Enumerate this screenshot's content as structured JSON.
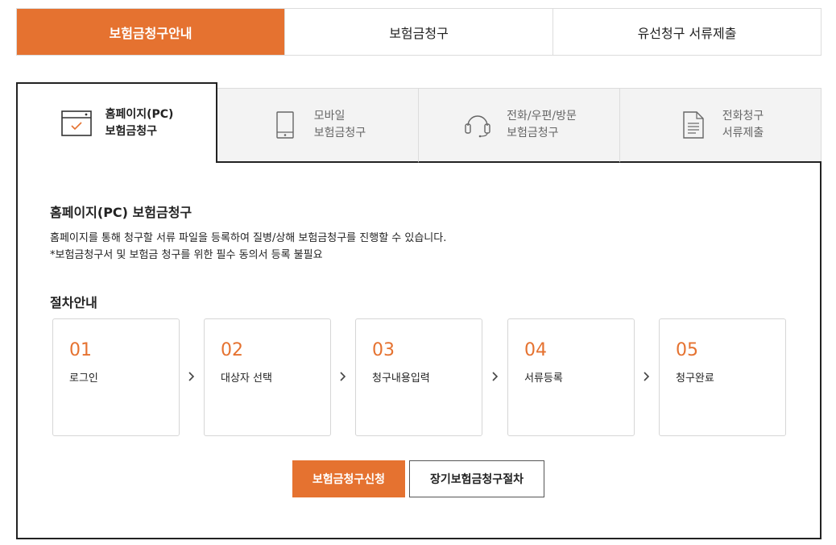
{
  "top_tabs": [
    {
      "label": "보험금청구안내",
      "active": true
    },
    {
      "label": "보험금청구",
      "active": false
    },
    {
      "label": "유선청구 서류제출",
      "active": false
    }
  ],
  "sub_tabs": [
    {
      "line1": "홈페이지(PC)",
      "line2": "보험금청구",
      "icon": "browser-window-icon",
      "active": true
    },
    {
      "line1": "모바일",
      "line2": "보험금청구",
      "icon": "mobile-phone-icon",
      "active": false
    },
    {
      "line1": "전화/우편/방문",
      "line2": "보험금청구",
      "icon": "headset-icon",
      "active": false
    },
    {
      "line1": "전화청구",
      "line2": "서류제출",
      "icon": "document-icon",
      "active": false
    }
  ],
  "section": {
    "title": "홈페이지(PC) 보험금청구",
    "desc_line1": "홈페이지를 통해 청구할 서류 파일을 등록하여 질병/상해 보험금청구를 진행할 수 있습니다.",
    "desc_line2": "*보험금청구서 및 보험금 청구를 위한 필수 동의서 등록 불필요"
  },
  "procedure": {
    "title": "절차안내",
    "steps": [
      {
        "num": "01",
        "name": "로그인"
      },
      {
        "num": "02",
        "name": "대상자 선택"
      },
      {
        "num": "03",
        "name": "청구내용입력"
      },
      {
        "num": "04",
        "name": "서류등록"
      },
      {
        "num": "05",
        "name": "청구완료"
      }
    ]
  },
  "buttons": {
    "apply": "보험금청구신청",
    "long_term": "장기보험금청구절차"
  },
  "colors": {
    "accent": "#e57230",
    "border_dark": "#222222",
    "tab_inactive_bg": "#f3f3f3"
  }
}
